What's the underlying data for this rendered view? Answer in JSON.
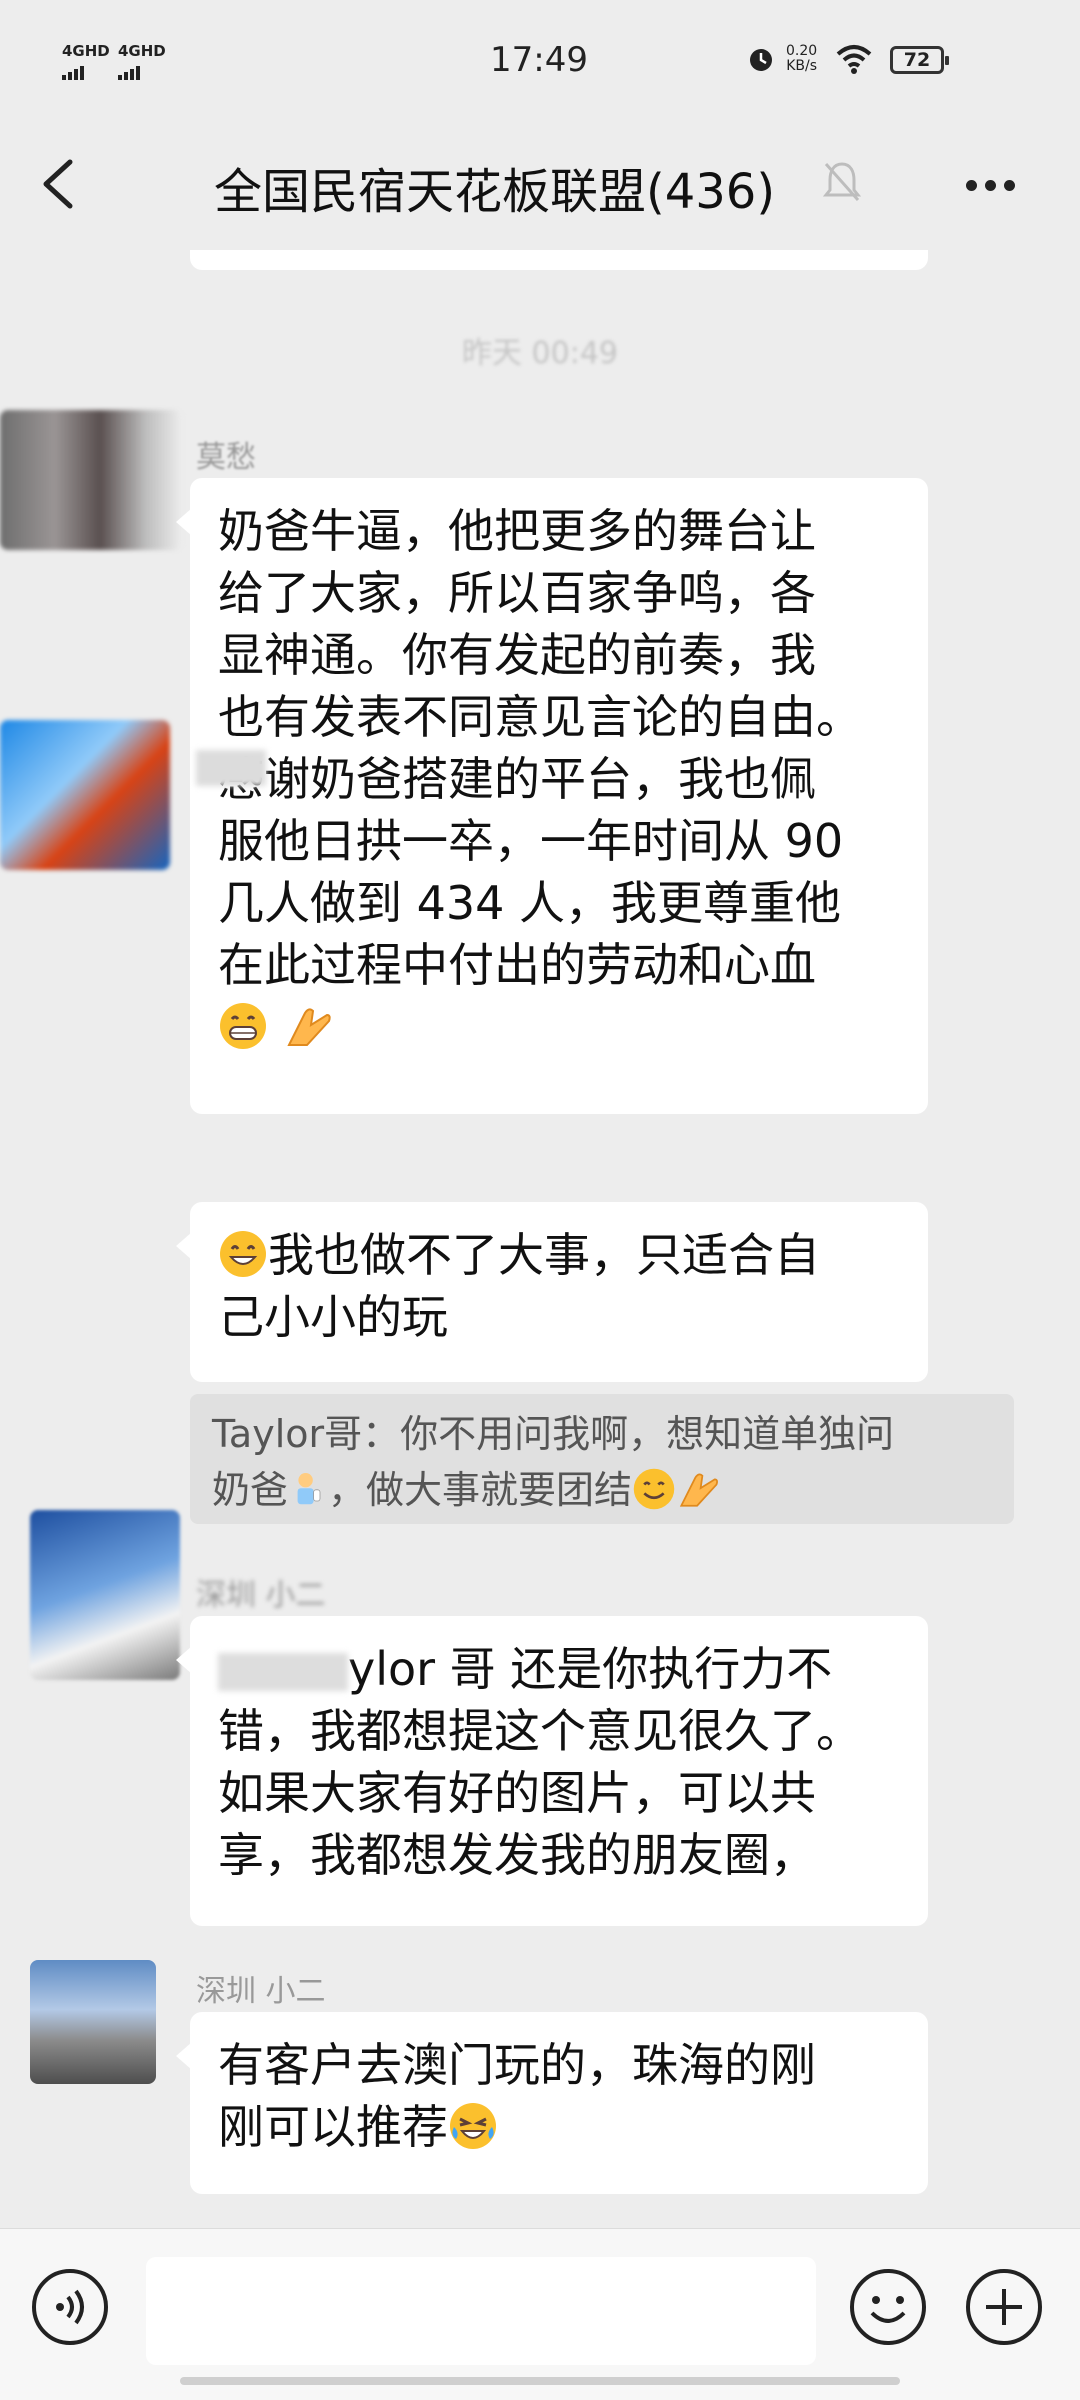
{
  "status_bar": {
    "signal1": "4GHD",
    "signal2": "4GHD",
    "time": "17:49",
    "speed_value": "0.20",
    "speed_unit": "KB/s",
    "battery": "72"
  },
  "header": {
    "title": "全国民宿天花板联盟(436)"
  },
  "chat": {
    "timestamp": "昨天 00:49",
    "messages": [
      {
        "sender": "莫愁",
        "lines": [
          "奶爸牛逼，他把更多的舞台让",
          "给了大家，所以百家争鸣，各",
          "显神通。你有发起的前奏，我",
          "也有发表不同意见言论的自由。",
          "感谢奶爸搭建的平台，我也佩",
          "服他日拱一卒，一年时间从 90",
          "几人做到 434 人，我更尊重他",
          "在此过程中付出的劳动和心血"
        ]
      },
      {
        "sender": "",
        "lines": [
          "我也做不了大事，只适合自",
          "己小小的玩"
        ]
      },
      {
        "quote_line1": "Taylor哥：你不用问我啊，想知道单独问",
        "quote_line2_a": "奶爸",
        "quote_line2_b": "，做大事就要团结"
      },
      {
        "sender": "深圳 小二",
        "line1_visible": "ylor 哥  还是你执行力不",
        "lines": [
          "错，我都想提这个意见很久了。",
          "如果大家有好的图片，可以共",
          "享，我都想发发我的朋友圈，"
        ]
      },
      {
        "sender": "深圳 小二",
        "lines": [
          "有客户去澳门玩的，珠海的刚",
          "刚可以推荐"
        ]
      }
    ]
  },
  "colors": {
    "background": "#ededed",
    "bubble": "#ffffff",
    "quote_bg": "#e0e0e0"
  },
  "icons": [
    "back-arrow-icon",
    "mute-bell-icon",
    "more-icon",
    "voice-icon",
    "emoji-icon",
    "plus-icon",
    "grin-emoji-icon",
    "clap-emoji-icon",
    "smile-emoji-icon",
    "cry-laugh-emoji-icon"
  ]
}
